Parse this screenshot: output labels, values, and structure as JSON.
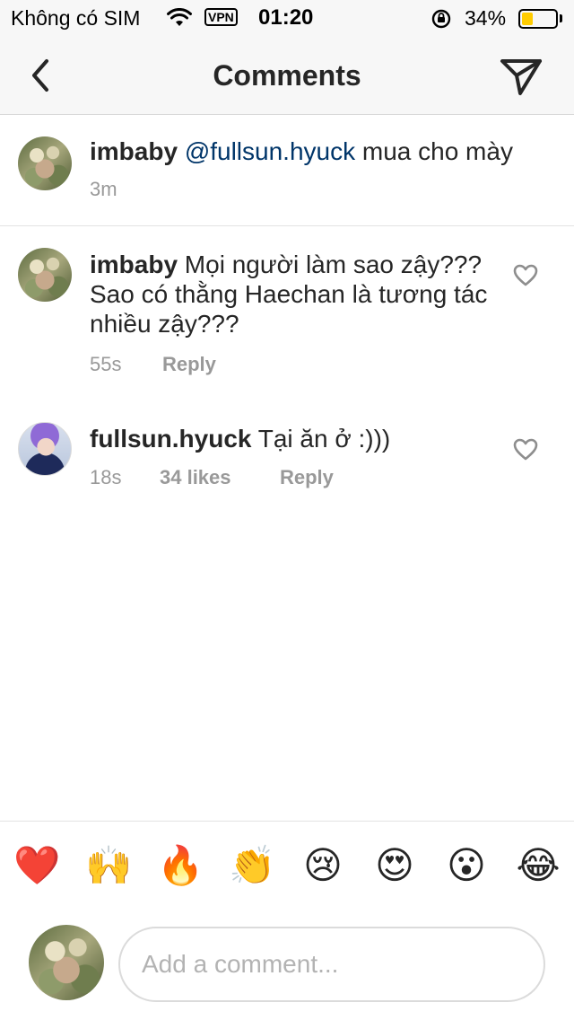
{
  "status_bar": {
    "carrier": "Không có SIM",
    "vpn": "VPN",
    "time": "01:20",
    "battery_percent_label": "34%",
    "battery_level": 0.34,
    "wifi_icon": "wifi-icon",
    "lock_icon": "orientation-lock-icon"
  },
  "nav": {
    "title": "Comments",
    "back_icon": "chevron-left-icon",
    "send_icon": "paper-plane-icon"
  },
  "caption": {
    "username": "imbaby",
    "mention": "@fullsun.hyuck",
    "text": " mua cho mày",
    "time": "3m"
  },
  "comments": [
    {
      "username": "imbaby",
      "text": " Mọi người làm sao zậy??? Sao có thằng Haechan là tương tác nhiều zậy???",
      "time": "55s",
      "likes": "",
      "reply_label": "Reply"
    },
    {
      "username": "fullsun.hyuck",
      "text": " Tại ăn ở :)))",
      "time": "18s",
      "likes": "34 likes",
      "reply_label": "Reply"
    }
  ],
  "emojis": [
    "❤️",
    "🙌",
    "🔥",
    "👏",
    "😢",
    "😍",
    "😮",
    "😂"
  ],
  "composer": {
    "placeholder": "Add a comment..."
  },
  "colors": {
    "mention": "#003569",
    "meta": "#999999",
    "battery": "#ffcc00"
  }
}
